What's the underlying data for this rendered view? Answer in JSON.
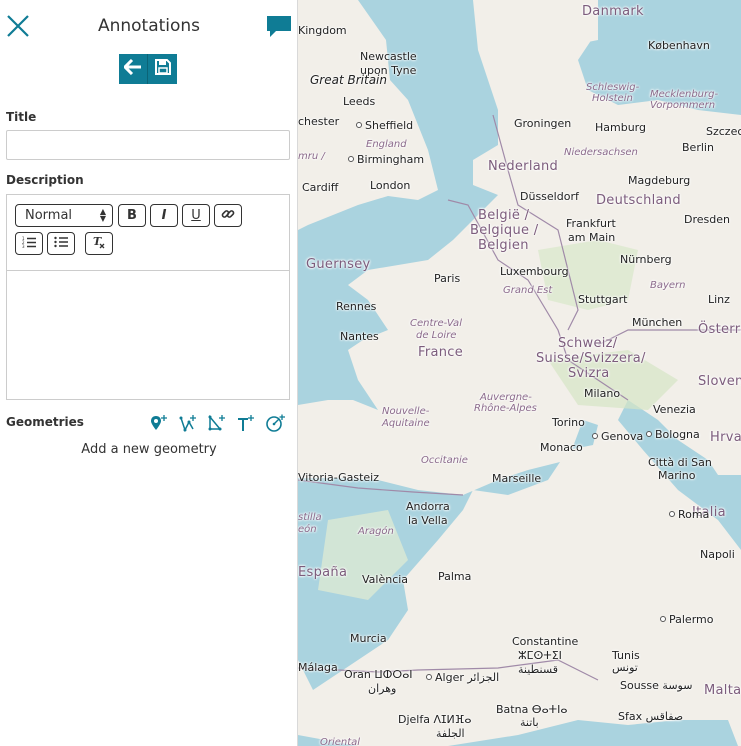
{
  "panel": {
    "title": "Annotations",
    "title_field_label": "Title",
    "title_value": "",
    "description_label": "Description",
    "format_select": "Normal",
    "editor_buttons": {
      "bold": "B",
      "italic": "I",
      "underline": "U"
    },
    "geometries_label": "Geometries",
    "add_geometry_text": "Add a new geometry"
  },
  "icons": [
    "close-icon",
    "comment-icon",
    "back-arrow-icon",
    "save-icon",
    "link-icon",
    "ordered-list-icon",
    "bullet-list-icon",
    "clear-format-icon",
    "add-marker-icon",
    "add-line-icon",
    "add-polygon-icon",
    "add-text-icon",
    "add-circle-icon"
  ],
  "colors": {
    "accent": "#0f7c95",
    "water": "#aad3df",
    "land": "#f2efe9"
  },
  "map": {
    "countries": [
      "Danmark",
      "Nederland",
      "België / Belgique / Belgien",
      "Deutschland",
      "France",
      "Schweiz/ Suisse/Svizzera/ Svizra",
      "Österreich",
      "Slovenija",
      "Hrvatska",
      "Italia",
      "España",
      "Guernsey"
    ],
    "regions": [
      "Great Britain",
      "England",
      "Cymru / Wales",
      "Schleswig-Holstein",
      "Mecklenburg-Vorpommern",
      "Niedersachsen",
      "Grand Est",
      "Bayern",
      "Centre-Val de Loire",
      "Auvergne-Rhône-Alpes",
      "Nouvelle-Aquitaine",
      "Occitanie",
      "Aragón",
      "Castilla y León",
      "Oriental"
    ],
    "cities": [
      "Newcastle upon Tyne",
      "Leeds",
      "Manchester",
      "Sheffield",
      "Birmingham",
      "Cardiff",
      "London",
      "København",
      "Hamburg",
      "Szczecin",
      "Groningen",
      "Berlin",
      "Magdeburg",
      "Düsseldorf",
      "Frankfurt am Main",
      "Dresden",
      "Luxembourg",
      "Nürnberg",
      "Paris",
      "Stuttgart",
      "Linz",
      "Rennes",
      "Nantes",
      "München",
      "Milano",
      "Venezia",
      "Torino",
      "Genova",
      "Bologna",
      "Monaco",
      "Città di San Marino",
      "Vitoria-Gasteiz",
      "Marseille",
      "Andorra la Vella",
      "Roma",
      "València",
      "Palma",
      "Napoli",
      "Murcia",
      "Palermo",
      "Málaga",
      "Constantine ⵣⵎⵙⵜⵉⵏ قسنطينة",
      "Oran ⵡⵀⵔⴰⵏ وهران",
      "Alger الجزائر",
      "Tunis تونس",
      "Sousse سوسة",
      "Sfax صفاقس",
      "Batna ⴱⴰⵜⵏⴰ باتنة",
      "Djelfa ⴷⵊⵍⴼⴰ الجلفة",
      "Malta",
      "Kingdom"
    ]
  }
}
